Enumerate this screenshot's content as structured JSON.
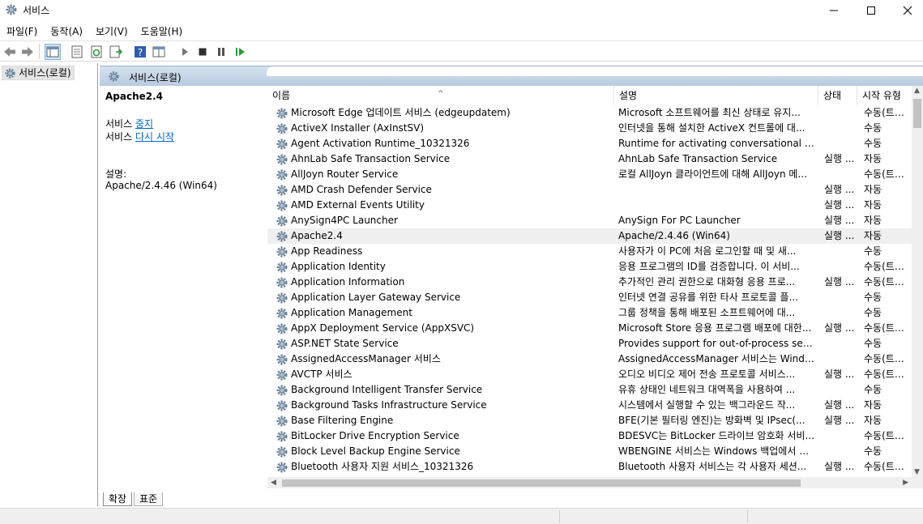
{
  "window": {
    "title": "서비스"
  },
  "menu": [
    "파일(F)",
    "동작(A)",
    "보기(V)",
    "도움말(H)"
  ],
  "toolbar": {
    "icons": [
      "back-icon",
      "forward-icon",
      "show-hide-tree-icon",
      "properties-icon",
      "refresh-icon",
      "export-list-icon",
      "help-icon",
      "view-icon",
      "start-icon",
      "stop-icon",
      "pause-icon",
      "resume-icon"
    ]
  },
  "tree": {
    "root_label": "서비스(로컬)"
  },
  "pane": {
    "header_label": "서비스(로컬)"
  },
  "description": {
    "service_name": "Apache2.4",
    "line1_prefix": "서비스 ",
    "line1_link": "중지",
    "line2_prefix": "서비스 ",
    "line2_link": "다시 시작",
    "desc_label": "설명:",
    "desc_text": "Apache/2.4.46 (Win64)"
  },
  "columns": {
    "name": "이름",
    "description": "설명",
    "status": "상태",
    "startup": "시작 유형"
  },
  "selected_index": 8,
  "rows": [
    {
      "name": "Microsoft Edge 업데이트 서비스 (edgeupdatem)",
      "description": "Microsoft 소프트웨어를 최신 상태로 유지...",
      "status": "",
      "startup": "수동(트리..."
    },
    {
      "name": "ActiveX Installer (AxInstSV)",
      "description": "인터넷을 통해 설치한 ActiveX 컨트롤에 대...",
      "status": "",
      "startup": "수동"
    },
    {
      "name": "Agent Activation Runtime_10321326",
      "description": "Runtime for activating conversational agen...",
      "status": "",
      "startup": "수동"
    },
    {
      "name": "AhnLab Safe Transaction Service",
      "description": "AhnLab Safe Transaction Service",
      "status": "실행 ...",
      "startup": "자동"
    },
    {
      "name": "AllJoyn Router Service",
      "description": "로컬 AllJoyn 클라이언트에 대해 AllJoyn 메...",
      "status": "",
      "startup": "수동(트리..."
    },
    {
      "name": "AMD Crash Defender Service",
      "description": "",
      "status": "실행 ...",
      "startup": "자동"
    },
    {
      "name": "AMD External Events Utility",
      "description": "",
      "status": "실행 ...",
      "startup": "자동"
    },
    {
      "name": "AnySign4PC Launcher",
      "description": "AnySign For PC Launcher",
      "status": "실행 ...",
      "startup": "자동"
    },
    {
      "name": "Apache2.4",
      "description": "Apache/2.4.46 (Win64)",
      "status": "실행 ...",
      "startup": "자동"
    },
    {
      "name": "App Readiness",
      "description": "사용자가 이 PC에 처음 로그인할 때 및 새...",
      "status": "",
      "startup": "수동"
    },
    {
      "name": "Application Identity",
      "description": "응용 프로그램의 ID를 검증합니다. 이 서비...",
      "status": "",
      "startup": "수동(트리..."
    },
    {
      "name": "Application Information",
      "description": "추가적인 관리 권한으로 대화형 응용 프로...",
      "status": "실행 ...",
      "startup": "수동(트리..."
    },
    {
      "name": "Application Layer Gateway Service",
      "description": "인터넷 연결 공유를 위한 타사 프로토콜 플...",
      "status": "",
      "startup": "수동"
    },
    {
      "name": "Application Management",
      "description": "그룹 정책을 통해 배포된 소프트웨어에 대...",
      "status": "",
      "startup": "수동"
    },
    {
      "name": "AppX Deployment Service (AppXSVC)",
      "description": "Microsoft Store 응용 프로그램 배포에 대한...",
      "status": "실행 ...",
      "startup": "수동(트리..."
    },
    {
      "name": "ASP.NET State Service",
      "description": "Provides support for out-of-process sessio...",
      "status": "",
      "startup": "수동"
    },
    {
      "name": "AssignedAccessManager 서비스",
      "description": "AssignedAccessManager 서비스는 Window...",
      "status": "",
      "startup": "수동(트리..."
    },
    {
      "name": "AVCTP 서비스",
      "description": "오디오 비디오 제어 전송 프로토콜 서비스...",
      "status": "실행 ...",
      "startup": "수동(트리..."
    },
    {
      "name": "Background Intelligent Transfer Service",
      "description": "유휴 상태인 네트워크 대역폭을 사용하여 ...",
      "status": "",
      "startup": "수동"
    },
    {
      "name": "Background Tasks Infrastructure Service",
      "description": "시스템에서 실행할 수 있는 백그라운드 작...",
      "status": "실행 ...",
      "startup": "자동"
    },
    {
      "name": "Base Filtering Engine",
      "description": "BFE(기본 필터링 엔진)는 방화벽 및 IPsec(...",
      "status": "실행 ...",
      "startup": "자동"
    },
    {
      "name": "BitLocker Drive Encryption Service",
      "description": "BDESVC는 BitLocker 드라이브 암호화 서비...",
      "status": "",
      "startup": "수동(트리..."
    },
    {
      "name": "Block Level Backup Engine Service",
      "description": "WBENGINE 서비스는 Windows 백업에서 백...",
      "status": "",
      "startup": "수동"
    },
    {
      "name": "Bluetooth 사용자 지원 서비스_10321326",
      "description": "Bluetooth 사용자 서비스는 각 사용자 세션...",
      "status": "실행 ...",
      "startup": "수동(트리..."
    }
  ],
  "bottom_tabs": [
    "확장",
    "표준"
  ]
}
